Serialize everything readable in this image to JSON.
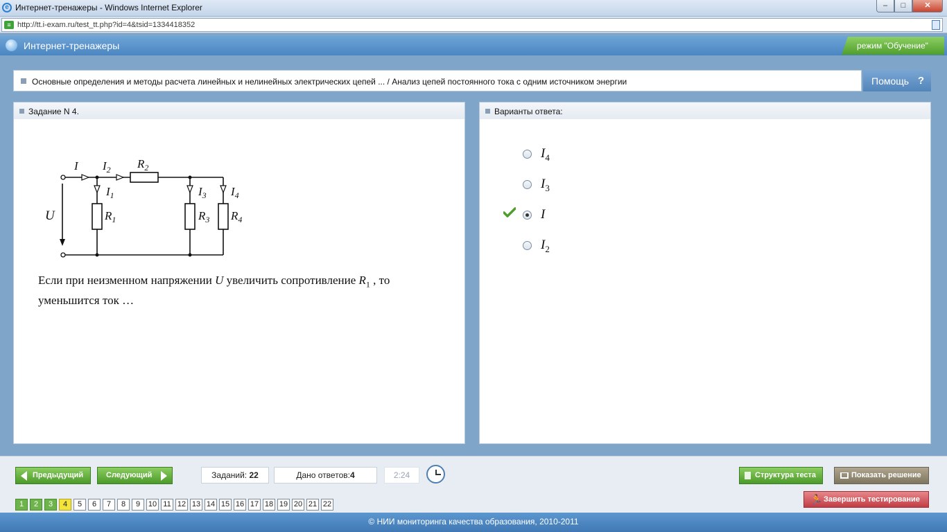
{
  "window": {
    "title": "Интернет-тренажеры - Windows Internet Explorer",
    "url": "http://tt.i-exam.ru/test_tt.php?id=4&tsid=1334418352"
  },
  "app": {
    "title": "Интернет-тренажеры",
    "mode": "режим \"Обучение\""
  },
  "breadcrumb": {
    "text": "Основные определения и методы расчета линейных и нелинейных электрических цепей ... / Анализ цепей постоянного тока с одним источником энергии",
    "help_label": "Помощь",
    "help_icon": "?"
  },
  "task": {
    "header": "Задание N 4.",
    "question_part1": "Если при неизменном напряжении ",
    "question_var_u": "U",
    "question_part2": " увеличить сопротивление ",
    "question_var_r": "R",
    "question_var_r_sub": "1",
    "question_part3": " , то уменьшится ток …",
    "circuit": {
      "I": "I",
      "I1": "I",
      "I1_sub": "1",
      "I2": "I",
      "I2_sub": "2",
      "I3": "I",
      "I3_sub": "3",
      "I4": "I",
      "I4_sub": "4",
      "R1": "R",
      "R1_sub": "1",
      "R2": "R",
      "R2_sub": "2",
      "R3": "R",
      "R3_sub": "3",
      "R4": "R",
      "R4_sub": "4",
      "U": "U"
    }
  },
  "answers": {
    "header": "Варианты ответа:",
    "options": [
      {
        "main": "I",
        "sub": "4",
        "checked": false
      },
      {
        "main": "I",
        "sub": "3",
        "checked": false
      },
      {
        "main": "I",
        "sub": "",
        "checked": true
      },
      {
        "main": "I",
        "sub": "2",
        "checked": false
      }
    ],
    "correct_icon": "check-icon"
  },
  "controls": {
    "prev_label": "Предыдущий",
    "next_label": "Следующий",
    "tasks_label": "Заданий:",
    "tasks_count": "22",
    "answers_label": "Дано ответов:",
    "answers_count": "4",
    "timer": "2:24",
    "structure_label": "Структура теста",
    "solution_label": "Показать решение",
    "finish_label": "Завершить тестирование"
  },
  "pages": {
    "numbers": [
      "1",
      "2",
      "3",
      "4",
      "5",
      "6",
      "7",
      "8",
      "9",
      "10",
      "11",
      "12",
      "13",
      "14",
      "15",
      "16",
      "17",
      "18",
      "19",
      "20",
      "21",
      "22"
    ],
    "done": [
      "1",
      "2",
      "3"
    ],
    "current": "4"
  },
  "footer": "© НИИ мониторинга качества образования, 2010-2011",
  "colors": {
    "accent_green": "#4b9a2a",
    "header_blue": "#4b86c2",
    "finish_red": "#c03d44",
    "current_page_yellow": "#f2e43a"
  }
}
